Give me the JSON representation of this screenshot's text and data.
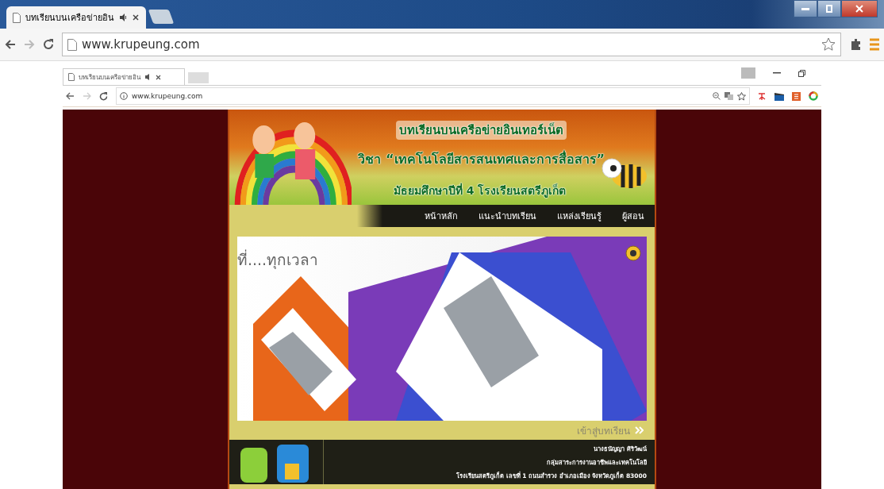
{
  "outer_browser": {
    "tab": {
      "title": "บทเรียนบนเครือข่ายอิน",
      "audio": true
    },
    "address": "www.krupeung.com"
  },
  "inner_browser": {
    "tab": {
      "title": "บทเรียนบนเครือข่ายอิน",
      "audio": true
    },
    "address": "www.krupeung.com"
  },
  "banner": {
    "title": "บทเรียนบนเครือข่ายอินเทอร์เน็ต",
    "subject_prefix": "วิชา",
    "subject": "“เทคโนโลยีสารสนเทศและการสื่อสาร”",
    "level_line": "มัธยมศึกษาปีที่ 4  โรงเรียนสตรีภูเก็ต"
  },
  "nav": [
    {
      "label": "หน้าหลัก"
    },
    {
      "label": "แนะนำบทเรียน"
    },
    {
      "label": "แหล่งเรียนรู้"
    },
    {
      "label": "ผู้สอน"
    }
  ],
  "slide": {
    "caption": "ที่....ทุกเวลา"
  },
  "enter_link": "เข้าสู่บทเรียน",
  "footer": [
    "นางธนัญญา ศิริวัฒน์",
    "กลุ่มสาระการงานอาชีพและเทคโนโลยี",
    "โรงเรียนสตรีภูเก็ต เลขที่ 1 ถนนสำรวง อำเภอเมือง จังหวัดภูเก็ต 83000"
  ]
}
